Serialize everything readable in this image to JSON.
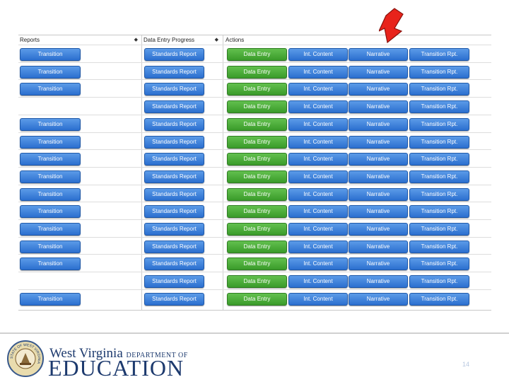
{
  "headers": {
    "reports": "Reports",
    "progress": "Data Entry Progress",
    "actions": "Actions",
    "sort_glyph": "◆"
  },
  "labels": {
    "transition": "Transition",
    "standards": "Standards Report",
    "data_entry": "Data Entry",
    "int_content": "Int. Content",
    "narrative": "Narrative",
    "transition_rpt": "Transition Rpt."
  },
  "rows": [
    {
      "transition": true
    },
    {
      "transition": true
    },
    {
      "transition": true
    },
    {
      "transition": false
    },
    {
      "transition": true
    },
    {
      "transition": true
    },
    {
      "transition": true
    },
    {
      "transition": true
    },
    {
      "transition": true
    },
    {
      "transition": true
    },
    {
      "transition": true
    },
    {
      "transition": true
    },
    {
      "transition": true
    },
    {
      "transition": false
    },
    {
      "transition": true
    }
  ],
  "colors": {
    "blue_button": "#2b6fcf",
    "green_button": "#3a9b2a",
    "arrow": "#e8231b",
    "brand_navy": "#1d3a6e"
  },
  "footer": {
    "org_name": "West Virginia",
    "dept": "DEPARTMENT OF",
    "edu": "EDUCATION",
    "seal_text": "STATE OF WEST VIRGINIA",
    "page_number": "14"
  },
  "icons": {
    "arrow": "red-arrow-icon",
    "seal": "state-seal-icon"
  }
}
